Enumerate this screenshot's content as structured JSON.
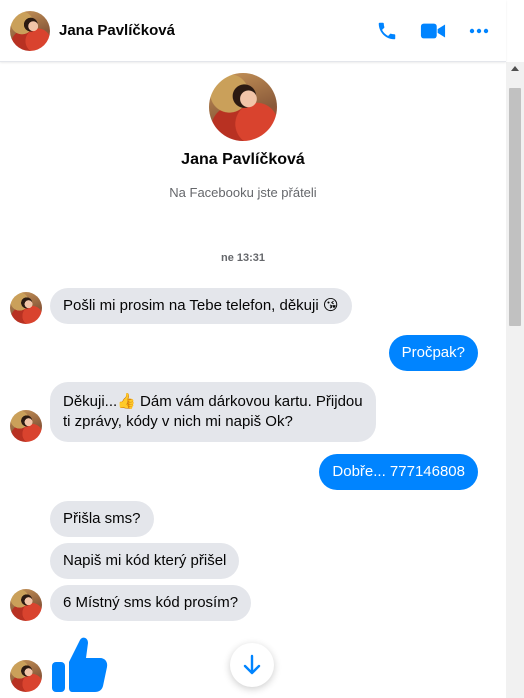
{
  "header": {
    "contact_name": "Jana Pavlíčková",
    "icons": [
      "phone-icon",
      "video-camera-icon",
      "more-options-icon"
    ]
  },
  "profile": {
    "name": "Jana Pavlíčková",
    "subtitle": "Na Facebooku jste přáteli"
  },
  "timestamp": "ne 13:31",
  "messages": [
    {
      "sender": "them",
      "text": "Pošli mi prosim na Tebe telefon, děkuji 😘"
    },
    {
      "sender": "me",
      "text": "Pročpak?"
    },
    {
      "sender": "them",
      "text": "Děkuji...👍 Dám vám dárkovou kartu. Přijdou\nti zprávy, kódy v nich mi napiš Ok?"
    },
    {
      "sender": "me",
      "text": "Dobře... 777146808"
    },
    {
      "sender": "them",
      "text": "Přišla sms?"
    },
    {
      "sender": "them",
      "text": "Napiš mi kód který přišel"
    },
    {
      "sender": "them",
      "text": "6 Místný sms kód prosím?"
    },
    {
      "sender": "them",
      "text": "",
      "type": "thumbs-up-sticker"
    }
  ],
  "colors": {
    "accent": "#0084ff",
    "incoming_bubble": "#e4e6eb",
    "secondary_text": "#65676b"
  }
}
